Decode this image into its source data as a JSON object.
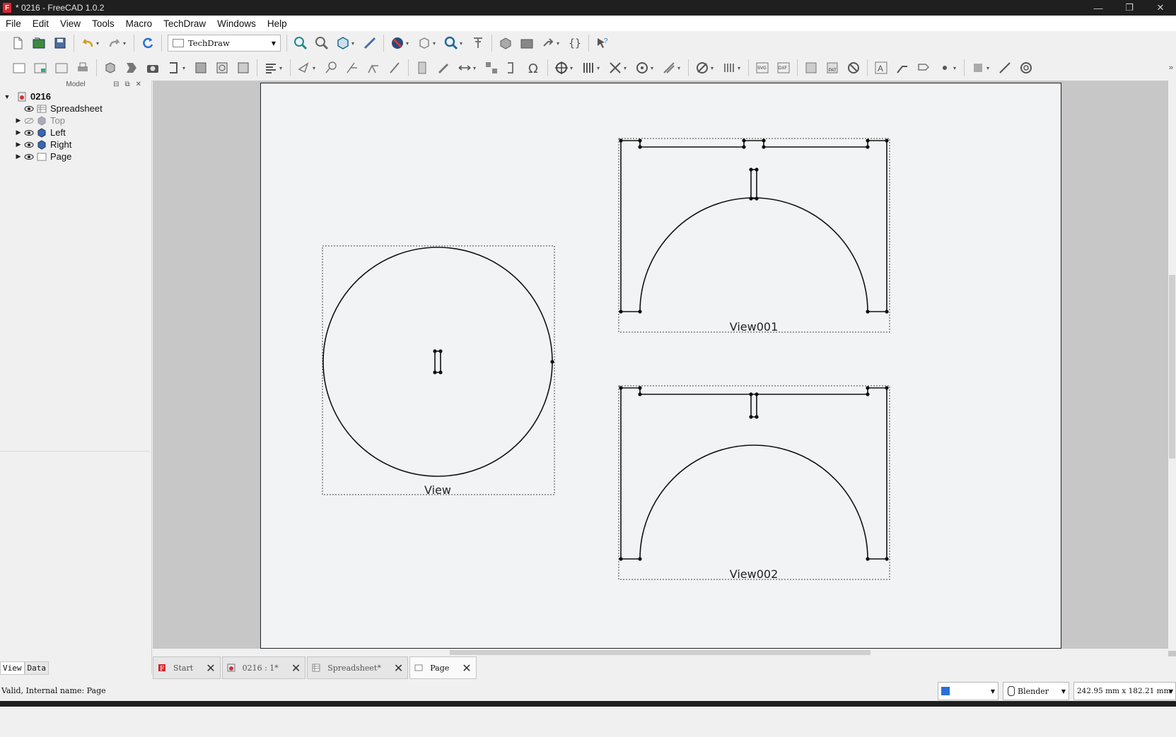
{
  "window": {
    "title": "* 0216 - FreeCAD 1.0.2",
    "app_icon": "freecad-icon"
  },
  "menu": [
    "File",
    "Edit",
    "View",
    "Tools",
    "Macro",
    "TechDraw",
    "Windows",
    "Help"
  ],
  "workbench": {
    "selected": "TechDraw"
  },
  "panel": {
    "header": "Model",
    "tree": {
      "root": "0216",
      "items": [
        {
          "label": "Spreadsheet",
          "icon": "spreadsheet-icon",
          "visible": true,
          "expandable": false
        },
        {
          "label": "Top",
          "icon": "part-icon",
          "visible": false,
          "expandable": true
        },
        {
          "label": "Left",
          "icon": "part-icon",
          "visible": true,
          "expandable": true
        },
        {
          "label": "Right",
          "icon": "part-icon",
          "visible": true,
          "expandable": true
        },
        {
          "label": "Page",
          "icon": "page-icon",
          "visible": true,
          "expandable": true
        }
      ]
    },
    "tabs": [
      "View",
      "Data"
    ]
  },
  "drawing": {
    "views": [
      "View",
      "View001",
      "View002"
    ]
  },
  "doc_tabs": [
    {
      "label": "Start",
      "icon": "freecad-icon",
      "active": false
    },
    {
      "label": "0216 : 1*",
      "icon": "part-icon",
      "active": false
    },
    {
      "label": "Spreadsheet*",
      "icon": "spreadsheet-icon",
      "active": false
    },
    {
      "label": "Page",
      "icon": "page-icon",
      "active": true
    }
  ],
  "status": {
    "message": "Valid, Internal name: Page",
    "navigation": "Blender",
    "dimensions": "242.95 mm x 182.21 mm"
  },
  "colors": {
    "accent": "#2a6fd6",
    "freecad_red": "#d8262f",
    "titlebar": "#1f1f1f"
  }
}
